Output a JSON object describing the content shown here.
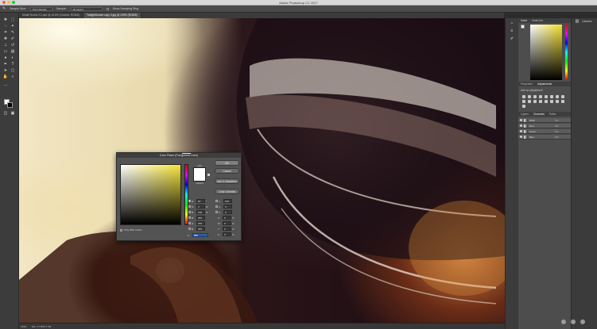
{
  "window": {
    "title": "Adobe Photoshop CC 2017"
  },
  "options_bar": {
    "sample_size_label": "Sample Size:",
    "sample_size_value": "Point Sample",
    "sample_label": "Sample:",
    "sample_value": "All Layers",
    "ring_label": "Show Sampling Ring"
  },
  "tabs": [
    {
      "label": "Model Scene 2-2.psd @ 16.6% (Colorful, RGB/8)",
      "active": false
    },
    {
      "label": "TwilightSunset copy 3.jpg @ 239% (RGB/8)",
      "active": true
    }
  ],
  "status_bar": {
    "zoom": "239%",
    "doc": "Doc: 17.5M/17.5M"
  },
  "panels": {
    "color_tabs": [
      "Color",
      "Swatches"
    ],
    "adjustments_tabs": [
      "Properties",
      "Adjustments"
    ],
    "adjustments_label": "Add an adjustment",
    "channels_tabs": [
      "Layers",
      "Channels",
      "Paths"
    ],
    "libraries_label": "Libraries",
    "channels": [
      {
        "name": "RGB",
        "key": "⌘2"
      },
      {
        "name": "Red",
        "key": "⌘3"
      },
      {
        "name": "Green",
        "key": "⌘4"
      },
      {
        "name": "Blue",
        "key": "⌘5"
      }
    ]
  },
  "dialog": {
    "title": "Color Picker (Foreground Color)",
    "new_label": "new",
    "current_label": "current",
    "buttons": {
      "ok": "OK",
      "cancel": "Cancel",
      "add_to_swatches": "Add to Swatches",
      "color_libraries": "Color Libraries"
    },
    "fields": {
      "H": {
        "value": "60",
        "unit": "°"
      },
      "S": {
        "value": "0",
        "unit": "%"
      },
      "B": {
        "value": "100",
        "unit": "%"
      },
      "R": {
        "value": "255",
        "unit": ""
      },
      "G": {
        "value": "255",
        "unit": ""
      },
      "Bl": {
        "value": "255",
        "unit": ""
      },
      "L": {
        "value": "100",
        "unit": ""
      },
      "a": {
        "value": "0",
        "unit": ""
      },
      "b": {
        "value": "0",
        "unit": ""
      },
      "C": {
        "value": "0",
        "unit": "%"
      },
      "M": {
        "value": "0",
        "unit": "%"
      },
      "Y": {
        "value": "0",
        "unit": "%"
      },
      "K": {
        "value": "0",
        "unit": "%"
      }
    },
    "hex_label": "#",
    "hex_value": "ffffff",
    "only_web_colors": "Only Web Colors",
    "selected_mode": "H"
  },
  "colors": {
    "foreground": "#ffffff",
    "background": "#000000",
    "hue_field": "#f5e43a"
  }
}
